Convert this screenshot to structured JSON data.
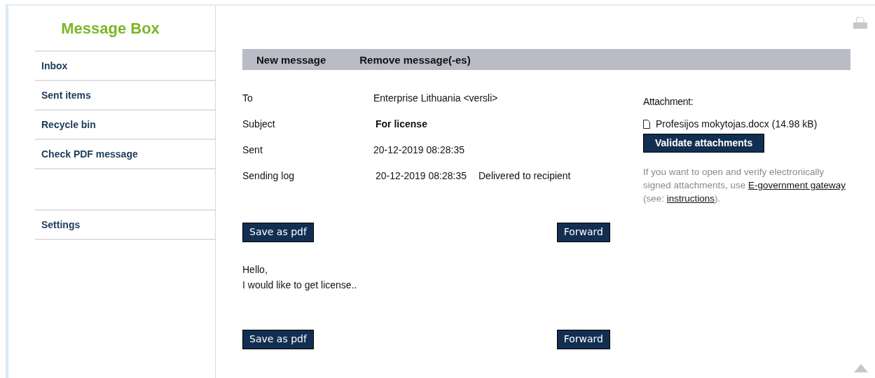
{
  "sidebar": {
    "title": "Message Box",
    "groups": [
      {
        "items": [
          "Inbox",
          "Sent items",
          "Recycle bin",
          "Check PDF message"
        ]
      },
      {
        "items": [
          "Settings"
        ]
      }
    ]
  },
  "toolbar": {
    "items": [
      "New message",
      "Remove message(-es)"
    ]
  },
  "details": [
    {
      "label": "To",
      "value": "Enterprise Lithuania <versli>",
      "kind": "plain"
    },
    {
      "label": "Subject",
      "value": "For license",
      "kind": "bold"
    },
    {
      "label": "Sent",
      "value": "20-12-2019 08:28:35",
      "kind": "plain"
    },
    {
      "label": "Sending log",
      "value": "20-12-2019 08:28:35",
      "status": "Delivered to recipient",
      "kind": "log"
    }
  ],
  "attachments": {
    "label": "Attachment:",
    "files": [
      "Profesijos mokytojas.docx (14.98 kB)"
    ],
    "validate_button": "Validate attachments",
    "note": {
      "before": "If you want to open and verify electronically signed attachments, use ",
      "link1": "E-government gateway",
      "middle": " (see: ",
      "link2": "instructions",
      "after": ")."
    }
  },
  "top_actions": {
    "save": "Save as pdf",
    "forward": "Forward"
  },
  "body": [
    "Hello,",
    "I would like to get license.."
  ],
  "bottom_actions": {
    "save": "Save as pdf",
    "forward": "Forward"
  }
}
